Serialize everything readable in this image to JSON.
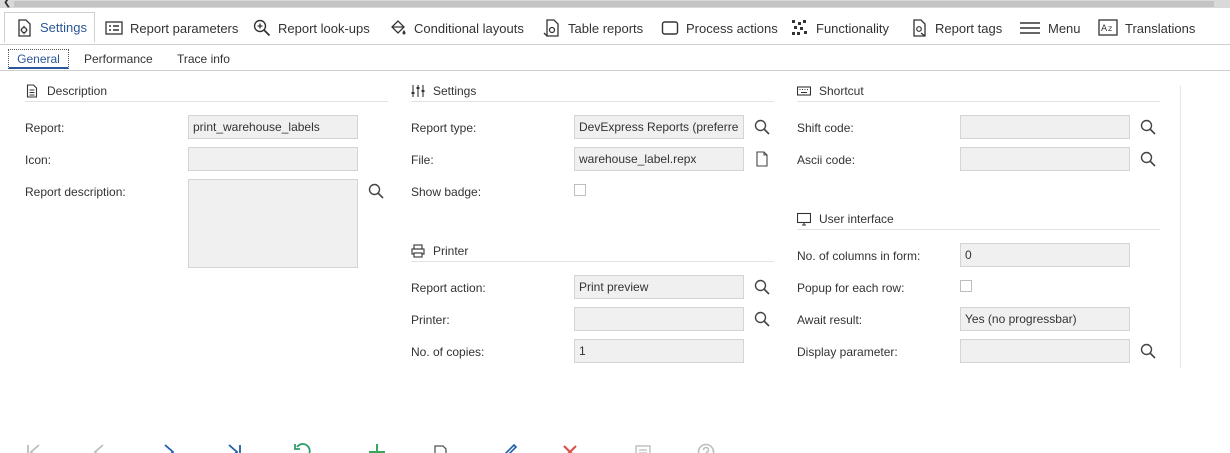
{
  "main_tabs": [
    {
      "label": "Settings",
      "icon": "settings-doc-icon"
    },
    {
      "label": "Report parameters",
      "icon": "list-icon"
    },
    {
      "label": "Report look-ups",
      "icon": "zoom-in-icon"
    },
    {
      "label": "Conditional layouts",
      "icon": "paint-bucket-icon"
    },
    {
      "label": "Table reports",
      "icon": "table-report-icon"
    },
    {
      "label": "Process actions",
      "icon": "square-icon"
    },
    {
      "label": "Functionality",
      "icon": "functionality-icon"
    },
    {
      "label": "Report tags",
      "icon": "tag-icon"
    },
    {
      "label": "Menu",
      "icon": "hamburger-icon"
    },
    {
      "label": "Translations",
      "icon": "translate-icon"
    }
  ],
  "sub_tabs": [
    "General",
    "Performance",
    "Trace info"
  ],
  "description": {
    "header": "Description",
    "report_label": "Report:",
    "report_value": "print_warehouse_labels",
    "icon_label": "Icon:",
    "icon_value": "",
    "report_description_label": "Report description:",
    "report_description_value": ""
  },
  "settings": {
    "header": "Settings",
    "report_type_label": "Report type:",
    "report_type_value": "DevExpress Reports (preferre",
    "file_label": "File:",
    "file_value": "warehouse_label.repx",
    "show_badge_label": "Show badge:"
  },
  "printer": {
    "header": "Printer",
    "report_action_label": "Report action:",
    "report_action_value": "Print preview",
    "printer_label": "Printer:",
    "printer_value": "",
    "copies_label": "No. of copies:",
    "copies_value": "1"
  },
  "shortcut": {
    "header": "Shortcut",
    "shift_code_label": "Shift code:",
    "shift_code_value": "",
    "ascii_code_label": "Ascii code:",
    "ascii_code_value": ""
  },
  "user_interface": {
    "header": "User interface",
    "columns_label": "No. of columns in form:",
    "columns_value": "0",
    "popup_label": "Popup for each row:",
    "await_label": "Await result:",
    "await_value": "Yes (no progressbar)",
    "display_param_label": "Display parameter:",
    "display_param_value": ""
  },
  "colors": {
    "accent": "#2b579a",
    "field_bg": "#f0f0f0",
    "nav_blue": "#1f5fa8",
    "undo_green": "#2e9e6a",
    "add_green": "#3aa55d",
    "delete_red": "#d9534f",
    "disabled_gray": "#bdbdbd"
  }
}
